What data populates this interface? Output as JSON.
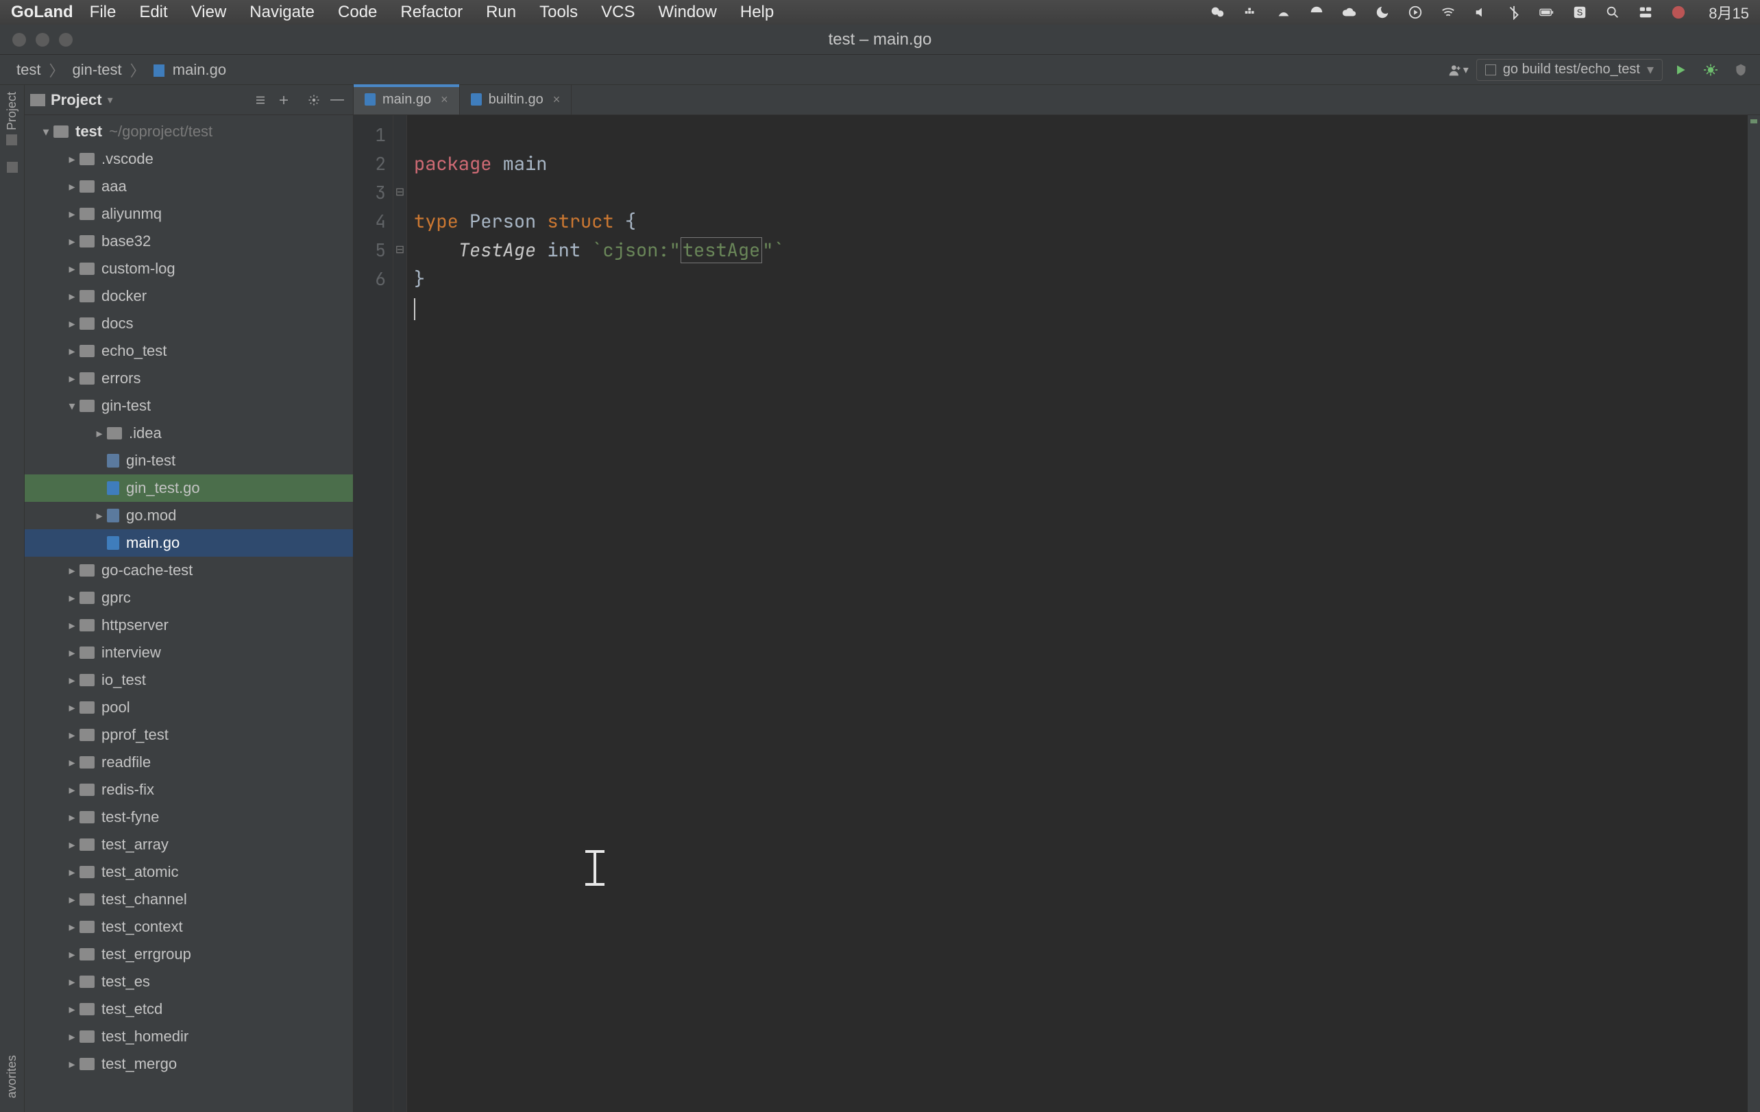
{
  "menubar": {
    "app": "GoLand",
    "items": [
      "File",
      "Edit",
      "View",
      "Navigate",
      "Code",
      "Refactor",
      "Run",
      "Tools",
      "VCS",
      "Window",
      "Help"
    ],
    "date": "8月15"
  },
  "titlebar": {
    "title": "test – main.go"
  },
  "breadcrumbs": [
    "test",
    "gin-test",
    "main.go"
  ],
  "runconfig": {
    "label": "go build test/echo_test"
  },
  "project": {
    "header": "Project",
    "root": {
      "name": "test",
      "path": "~/goproject/test"
    },
    "tree": [
      {
        "name": ".vscode",
        "depth": 1,
        "arrow": "closed",
        "type": "folder"
      },
      {
        "name": "aaa",
        "depth": 1,
        "arrow": "closed",
        "type": "folder"
      },
      {
        "name": "aliyunmq",
        "depth": 1,
        "arrow": "closed",
        "type": "folder"
      },
      {
        "name": "base32",
        "depth": 1,
        "arrow": "closed",
        "type": "folder"
      },
      {
        "name": "custom-log",
        "depth": 1,
        "arrow": "closed",
        "type": "folder"
      },
      {
        "name": "docker",
        "depth": 1,
        "arrow": "closed",
        "type": "folder"
      },
      {
        "name": "docs",
        "depth": 1,
        "arrow": "closed",
        "type": "folder"
      },
      {
        "name": "echo_test",
        "depth": 1,
        "arrow": "closed",
        "type": "folder"
      },
      {
        "name": "errors",
        "depth": 1,
        "arrow": "closed",
        "type": "folder"
      },
      {
        "name": "gin-test",
        "depth": 1,
        "arrow": "open",
        "type": "folder"
      },
      {
        "name": ".idea",
        "depth": 2,
        "arrow": "closed",
        "type": "folder"
      },
      {
        "name": "gin-test",
        "depth": 2,
        "arrow": "none",
        "type": "file"
      },
      {
        "name": "gin_test.go",
        "depth": 2,
        "arrow": "none",
        "type": "go",
        "sel": "soft"
      },
      {
        "name": "go.mod",
        "depth": 2,
        "arrow": "closed",
        "type": "file"
      },
      {
        "name": "main.go",
        "depth": 2,
        "arrow": "none",
        "type": "go",
        "sel": "hard"
      },
      {
        "name": "go-cache-test",
        "depth": 1,
        "arrow": "closed",
        "type": "folder"
      },
      {
        "name": "gprc",
        "depth": 1,
        "arrow": "closed",
        "type": "folder"
      },
      {
        "name": "httpserver",
        "depth": 1,
        "arrow": "closed",
        "type": "folder"
      },
      {
        "name": "interview",
        "depth": 1,
        "arrow": "closed",
        "type": "folder"
      },
      {
        "name": "io_test",
        "depth": 1,
        "arrow": "closed",
        "type": "folder"
      },
      {
        "name": "pool",
        "depth": 1,
        "arrow": "closed",
        "type": "folder"
      },
      {
        "name": "pprof_test",
        "depth": 1,
        "arrow": "closed",
        "type": "folder"
      },
      {
        "name": "readfile",
        "depth": 1,
        "arrow": "closed",
        "type": "folder"
      },
      {
        "name": "redis-fix",
        "depth": 1,
        "arrow": "closed",
        "type": "folder"
      },
      {
        "name": "test-fyne",
        "depth": 1,
        "arrow": "closed",
        "type": "folder"
      },
      {
        "name": "test_array",
        "depth": 1,
        "arrow": "closed",
        "type": "folder"
      },
      {
        "name": "test_atomic",
        "depth": 1,
        "arrow": "closed",
        "type": "folder"
      },
      {
        "name": "test_channel",
        "depth": 1,
        "arrow": "closed",
        "type": "folder"
      },
      {
        "name": "test_context",
        "depth": 1,
        "arrow": "closed",
        "type": "folder"
      },
      {
        "name": "test_errgroup",
        "depth": 1,
        "arrow": "closed",
        "type": "folder"
      },
      {
        "name": "test_es",
        "depth": 1,
        "arrow": "closed",
        "type": "folder"
      },
      {
        "name": "test_etcd",
        "depth": 1,
        "arrow": "closed",
        "type": "folder"
      },
      {
        "name": "test_homedir",
        "depth": 1,
        "arrow": "closed",
        "type": "folder"
      },
      {
        "name": "test_mergo",
        "depth": 1,
        "arrow": "closed",
        "type": "folder"
      }
    ]
  },
  "tabs": [
    {
      "label": "main.go",
      "active": true
    },
    {
      "label": "builtin.go",
      "active": false
    }
  ],
  "code": {
    "lines": [
      "1",
      "2",
      "3",
      "4",
      "5",
      "6"
    ],
    "l1_kw": "package",
    "l1_pkg": "main",
    "l3_kw1": "type",
    "l3_ident": "Person",
    "l3_kw2": "struct",
    "l3_brace": "{",
    "l4_field": "TestAge",
    "l4_type": "int",
    "l4_tag_open": "`cjson:\"",
    "l4_tag_val": "testAge",
    "l4_tag_close": "\"`",
    "l5_brace": "}"
  },
  "sidebar_labels": {
    "project": "Project",
    "favorites": "avorites"
  }
}
